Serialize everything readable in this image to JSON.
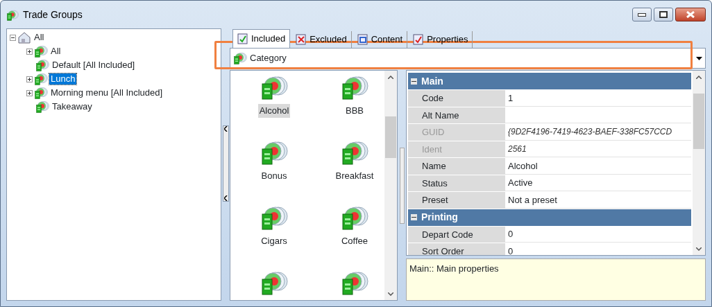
{
  "window": {
    "title": "Trade Groups"
  },
  "tree": [
    {
      "label": "All",
      "kind": "root",
      "expanded": true,
      "selected": false,
      "children": [
        {
          "label": "All",
          "kind": "group",
          "expanded": false,
          "selected": false
        },
        {
          "label": "Default [All Included]",
          "kind": "group",
          "selected": false
        },
        {
          "label": "Lunch",
          "kind": "group",
          "expanded": false,
          "selected": true
        },
        {
          "label": "Morning menu [All Included]",
          "kind": "group",
          "expanded": false,
          "selected": false
        },
        {
          "label": "Takeaway",
          "kind": "group",
          "selected": false
        }
      ]
    }
  ],
  "tabs": [
    {
      "label": "Included",
      "kind": "included",
      "selected": true
    },
    {
      "label": "Excluded",
      "kind": "excluded",
      "selected": false
    },
    {
      "label": "Content",
      "kind": "content",
      "selected": false
    },
    {
      "label": "Properties",
      "kind": "properties",
      "selected": false
    }
  ],
  "category_combo": {
    "value": "Category"
  },
  "items": [
    {
      "kind": "labeled",
      "label": "Alcohol",
      "selected": true
    },
    {
      "kind": "labeled",
      "label": "BBB",
      "selected": false
    },
    {
      "kind": "labeled",
      "label": "Bonus",
      "selected": false
    },
    {
      "kind": "labeled",
      "label": "Breakfast",
      "selected": false
    },
    {
      "kind": "labeled",
      "label": "Cigars",
      "selected": false
    },
    {
      "kind": "labeled",
      "label": "Coffee",
      "selected": false
    },
    {
      "kind": "cut_off"
    },
    {
      "kind": "cut_off"
    }
  ],
  "property_grid": {
    "sections": [
      {
        "title": "Main",
        "expanded": true,
        "rows": [
          {
            "name": "Code",
            "value": "1",
            "disabled": false
          },
          {
            "name": "Alt Name",
            "value": "",
            "disabled": false
          },
          {
            "name": "GUID",
            "value": "{9D2F4196-7419-4623-BAEF-338FC57CCD",
            "disabled": true
          },
          {
            "name": "Ident",
            "value": "2561",
            "disabled": true
          },
          {
            "name": "Name",
            "value": "Alcohol",
            "disabled": false
          },
          {
            "name": "Status",
            "value": "Active",
            "disabled": false
          },
          {
            "name": "Preset",
            "value": "Not a preset",
            "disabled": false
          }
        ]
      },
      {
        "title": "Printing",
        "expanded": true,
        "rows": [
          {
            "name": "Depart Code",
            "value": "0",
            "disabled": false
          },
          {
            "name": "Sort Order",
            "value": "0",
            "disabled": false
          }
        ]
      }
    ]
  },
  "description": "Main:: Main properties"
}
